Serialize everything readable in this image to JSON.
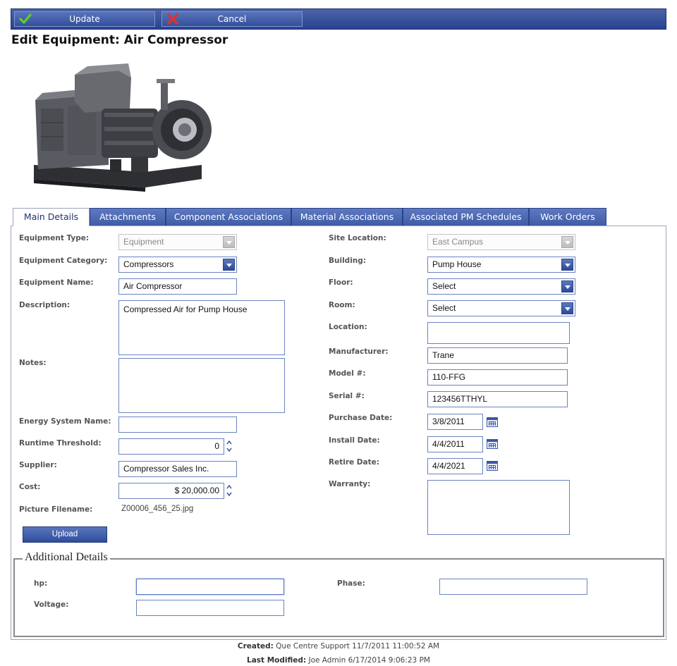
{
  "toolbar": {
    "update_label": "Update",
    "cancel_label": "Cancel"
  },
  "page": {
    "title": "Edit Equipment: Air Compressor"
  },
  "tabs": [
    {
      "label": "Main Details",
      "active": true
    },
    {
      "label": "Attachments"
    },
    {
      "label": "Component Associations"
    },
    {
      "label": "Material Associations"
    },
    {
      "label": "Associated PM Schedules"
    },
    {
      "label": "Work Orders"
    }
  ],
  "left": {
    "equipment_type": {
      "label": "Equipment Type:",
      "value": "Equipment"
    },
    "equipment_category": {
      "label": "Equipment Category:",
      "value": "Compressors"
    },
    "equipment_name": {
      "label": "Equipment Name:",
      "value": "Air Compressor"
    },
    "description": {
      "label": "Description:",
      "value": "Compressed Air for Pump House"
    },
    "notes": {
      "label": "Notes:",
      "value": ""
    },
    "energy_system_name": {
      "label": "Energy System Name:",
      "value": ""
    },
    "runtime_threshold": {
      "label": "Runtime Threshold:",
      "value": "0"
    },
    "supplier": {
      "label": "Supplier:",
      "value": "Compressor Sales Inc."
    },
    "cost": {
      "label": "Cost:",
      "value": "$ 20,000.00"
    },
    "picture_filename": {
      "label": "Picture Filename:",
      "value": "Z00006_456_25.jpg"
    },
    "upload_label": "Upload"
  },
  "right": {
    "site_location": {
      "label": "Site Location:",
      "value": "East Campus"
    },
    "building": {
      "label": "Building:",
      "value": "Pump House"
    },
    "floor": {
      "label": "Floor:",
      "value": "Select"
    },
    "room": {
      "label": "Room:",
      "value": "Select"
    },
    "location": {
      "label": "Location:",
      "value": ""
    },
    "manufacturer": {
      "label": "Manufacturer:",
      "value": "Trane"
    },
    "model": {
      "label": "Model #:",
      "value": "110-FFG"
    },
    "serial": {
      "label": "Serial #:",
      "value": "123456TTHYL"
    },
    "purchase_date": {
      "label": "Purchase Date:",
      "value": "3/8/2011"
    },
    "install_date": {
      "label": "Install Date:",
      "value": "4/4/2011"
    },
    "retire_date": {
      "label": "Retire Date:",
      "value": "4/4/2021"
    },
    "warranty": {
      "label": "Warranty:",
      "value": ""
    }
  },
  "additional": {
    "legend": "Additional Details",
    "hp": {
      "label": "hp:",
      "value": ""
    },
    "voltage": {
      "label": "Voltage:",
      "value": ""
    },
    "phase": {
      "label": "Phase:",
      "value": ""
    }
  },
  "footer": {
    "created_label": "Created:",
    "created_value": "Que Centre Support 11/7/2011 11:00:52 AM",
    "modified_label": "Last Modified:",
    "modified_value": "Joe Admin 6/17/2014 9:06:23 PM"
  },
  "colors": {
    "accent": "#3f5ba7",
    "toolbar": "#2a4290",
    "border": "#6a83c0"
  },
  "icons": {
    "update": "checkmark-icon",
    "cancel": "x-icon",
    "calendar": "calendar-icon"
  }
}
